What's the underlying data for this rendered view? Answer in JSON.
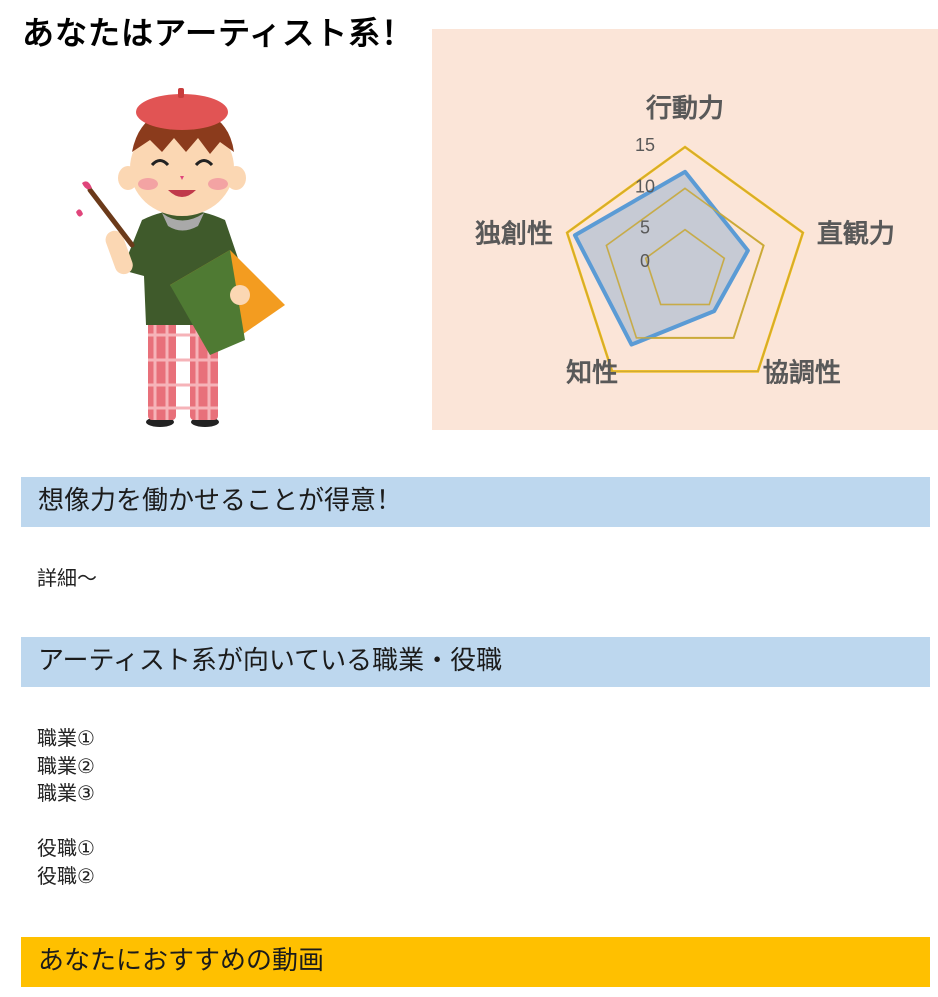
{
  "header": {
    "title": "あなたはアーティスト系！"
  },
  "illustration": {
    "icon": "artist-character-icon",
    "colors": {
      "beret": "#e15454",
      "hair": "#8b3b1c",
      "skin": "#fbd7b3",
      "shirt": "#3f5a2b",
      "pants": "#e8707a",
      "folder": "#f39c20"
    }
  },
  "chart_data": {
    "type": "radar",
    "axes": [
      "行動力",
      "直観力",
      "協調性",
      "知性",
      "独創性"
    ],
    "tick_labels": [
      "0",
      "5",
      "10",
      "15"
    ],
    "rlim": [
      0,
      15
    ],
    "gridlines": [
      0,
      5,
      10,
      15
    ],
    "grid_color": "#ffc000",
    "series": [
      {
        "values": [
          12,
          8,
          6,
          11,
          14
        ],
        "color": "#5b9bd5",
        "fill": "#bcc5d3"
      }
    ],
    "background": "#fbe5d8"
  },
  "sections": [
    {
      "title": "想像力を働かせることが得意！",
      "body": [
        "詳細～"
      ]
    },
    {
      "title": "アーティスト系が向いている職業・役職",
      "body": [
        "職業①",
        "職業②",
        "職業③",
        "",
        "役職①",
        "役職②"
      ]
    },
    {
      "title": "あなたにおすすめの動画"
    }
  ],
  "colors": {
    "section_header_bg": "#bdd7ee",
    "video_header_bg": "#ffc000"
  }
}
